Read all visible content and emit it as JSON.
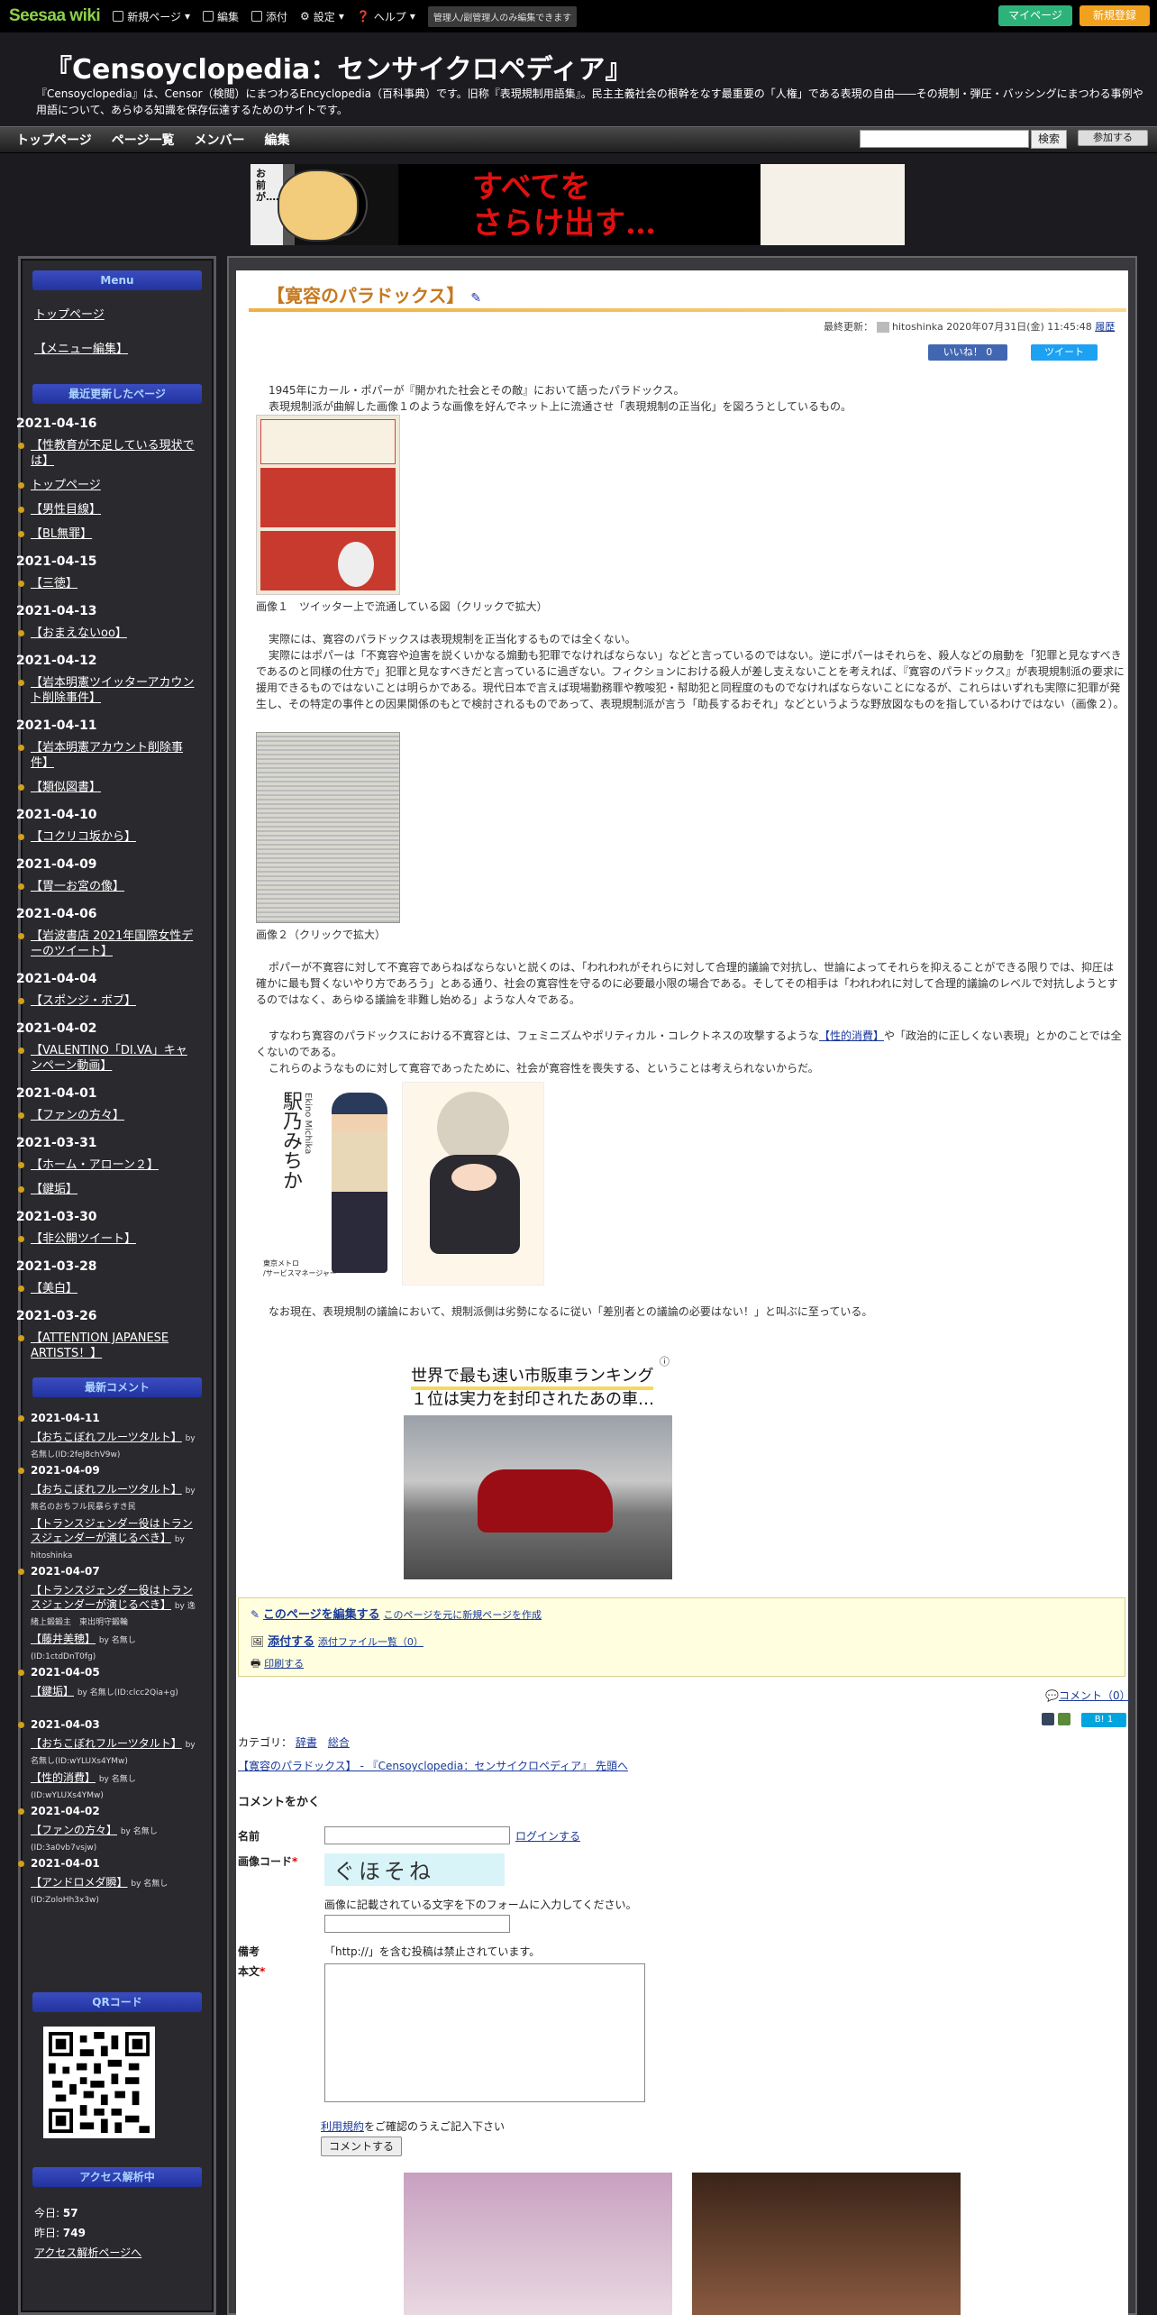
{
  "topbar": {
    "logo": "Seesaa",
    "logo_wiki": "wiki",
    "menu": [
      "新規ページ",
      "編集",
      "添付",
      "設定",
      "ヘルプ"
    ],
    "note": "管理人/副管理人のみ編集できます",
    "mypage": "マイページ",
    "new_register": "新規登録"
  },
  "header": {
    "title": "『Censoyclopedia：センサイクロペディア』",
    "description": "『Censoyclopedia』は、Censor（検閲）にまつわるEncyclopedia（百科事典）です。旧称『表現規制用語集』。民主主義社会の根幹をなす最重要の「人権」である表現の自由――その規制・弾圧・バッシングにまつわる事例や用語について、あらゆる知識を保存伝達するためのサイトです。"
  },
  "nav": {
    "items": [
      "トップページ",
      "ページ一覧",
      "メンバー",
      "編集"
    ],
    "search_button": "検索",
    "join_button": "参加する"
  },
  "banner": {
    "left_text": "お前が……",
    "main_line1": "すべてを",
    "main_line2": "さらけ出す…"
  },
  "sidebar": {
    "menu_title": "Menu",
    "menu_links": [
      "トップページ",
      "【メニュー編集】"
    ],
    "recent_title": "最近更新したページ",
    "recent": [
      {
        "date": "2021-04-16",
        "items": [
          "【性教育が不足している現状では】",
          "トップページ",
          "【男性目線】",
          "【BL無罪】"
        ]
      },
      {
        "date": "2021-04-15",
        "items": [
          "【三徳】"
        ]
      },
      {
        "date": "2021-04-13",
        "items": [
          "【おまえないoo】"
        ]
      },
      {
        "date": "2021-04-12",
        "items": [
          "【岩本明憲ツイッターアカウント削除事件】"
        ]
      },
      {
        "date": "2021-04-11",
        "items": [
          "【岩本明憲アカウント削除事件】",
          "【類似図書】"
        ]
      },
      {
        "date": "2021-04-10",
        "items": [
          "【コクリコ坂から】"
        ]
      },
      {
        "date": "2021-04-09",
        "items": [
          "【胃一お宮の像】"
        ]
      },
      {
        "date": "2021-04-06",
        "items": [
          "【岩波書店 2021年国際女性デーのツイート】"
        ]
      },
      {
        "date": "2021-04-04",
        "items": [
          "【スポンジ・ボブ】"
        ]
      },
      {
        "date": "2021-04-02",
        "items": [
          "【VALENTINO「DI.VA」キャンペーン動画】"
        ]
      },
      {
        "date": "2021-04-01",
        "items": [
          "【ファンの方々】"
        ]
      },
      {
        "date": "2021-03-31",
        "items": [
          "【ホーム・アローン２】",
          "【鍵垢】"
        ]
      },
      {
        "date": "2021-03-30",
        "items": [
          "【非公開ツイート】"
        ]
      },
      {
        "date": "2021-03-28",
        "items": [
          "【美白】"
        ]
      },
      {
        "date": "2021-03-26",
        "items": [
          "【ATTENTION JAPANESE ARTISTS！】"
        ]
      }
    ],
    "comments_title": "最新コメント",
    "comments": [
      {
        "date": "2021-04-11",
        "entries": [
          {
            "title": "【おちこぼれフルーツタルト】",
            "by": "by 名無し(ID:2feJ8chV9w)"
          }
        ]
      },
      {
        "date": "2021-04-09",
        "entries": [
          {
            "title": "【おちこぼれフルーツタルト】",
            "by": "by 無名のおちフル民暴らすき民"
          },
          {
            "title": "【トランスジェンダー役はトランスジェンダーが演じるべき】",
            "by": "by hitoshinka"
          }
        ]
      },
      {
        "date": "2021-04-07",
        "entries": [
          {
            "title": "【トランスジェンダー役はトランスジェンダーが演じるべき】",
            "by": "by 逸緒上鍛鍛主　東出明守鍛輪"
          },
          {
            "title": "【藤井美穂】",
            "by": "by 名無し(ID:1ctdDnT0fg)"
          }
        ]
      },
      {
        "date": "2021-04-05",
        "entries": [
          {
            "title": "【鍵垢】",
            "by": "by 名無し(ID:clcc2Qia+g)"
          }
        ]
      },
      {
        "date": "2021-04-03",
        "entries": [
          {
            "title": "【おちこぼれフルーツタルト】",
            "by": "by 名無し(ID:wYLUXs4YMw)"
          },
          {
            "title": "【性的消費】",
            "by": "by 名無し(ID:wYLUXs4YMw)"
          }
        ]
      },
      {
        "date": "2021-04-02",
        "entries": [
          {
            "title": "【ファンの方々】",
            "by": "by 名無し(ID:3a0vb7vsjw)"
          }
        ]
      },
      {
        "date": "2021-04-01",
        "entries": [
          {
            "title": "【アンドロメダ瞬】",
            "by": "by 名無し(ID:ZoloHh3x3w)"
          }
        ]
      }
    ],
    "qr_title": "QRコード",
    "access_title": "アクセス解析中",
    "today_label": "今日:",
    "today_value": "57",
    "yesterday_label": "昨日:",
    "yesterday_value": "749",
    "access_link": "アクセス解析ページへ"
  },
  "page": {
    "title": "【寛容のパラドックス】",
    "updated_label": "最終更新：",
    "updated_user": "hitoshinka",
    "updated_date": "2020年07月31日(金) 11:45:48",
    "history": "履歴",
    "like": "いいね！ 0",
    "tweet": "ツイート",
    "p1a": "1945年にカール・ポパーが『開かれた社会とその敵』において語ったパラドックス。",
    "p1b": "表現規制派が曲解した画像１のような画像を好んでネット上に流通させ「表現規制の正当化」を図ろうとしているもの。",
    "cap1": "画像１　ツイッター上で流通している図（クリックで拡大）",
    "p2a": "実際には、寛容のパラドックスは表現規制を正当化するものでは全くない。",
    "p2b": "実際にはポパーは「不寛容や迫害を説くいかなる煽動も犯罪でなければならない」などと言っているのではない。逆にポパーはそれらを、殺人などの扇動を「犯罪と見なすべきであるのと同様の仕方で」犯罪と見なすべきだと言っているに過ぎない。フィクションにおける殺人が差し支えないことを考えれば、『寛容のパラドックス』が表現規制派の要求に援用できるものではないことは明らかである。現代日本で言えば現場勤務罪や教唆犯・幇助犯と同程度のものでなければならないことになるが、これらはいずれも実際に犯罪が発生し、その特定の事件との因果関係のもとで検討されるものであって、表現規制派が言う「助長するおそれ」などというような野放図なものを指しているわけではない（画像２）。",
    "cap2": "画像２（クリックで拡大）",
    "p3": "ポパーが不寛容に対して不寛容であらねばならないと説くのは、「われわれがそれらに対して合理的議論で対抗し、世論によってそれらを抑えることができる限りでは、抑圧は確かに最も賢くないやり方であろう」とある通り、社会の寛容性を守るのに必要最小限の場合である。そしてその相手は「われわれに対して合理的議論のレベルで対抗しようとするのではなく、あらゆる議論を非難し始める」ような人々である。",
    "p4a": "すなわち寛容のパラドックスにおける不寛容とは、フェミニズムやポリティカル・コレクトネスの攻撃するような",
    "p4link": "【性的消費】",
    "p4b": "や「政治的に正しくない表現」とかのことでは全くないのである。",
    "p4c": "これらのようなものに対して寛容であったために、社会が寛容性を喪失する、ということは考えられないからだ。",
    "img3_name": "駅乃みちか",
    "img3_romaji": "Ekino Michika",
    "img3_caption": "東京メトロ\n/サービスマネージャー",
    "p5": "なお現在、表現規制の議論において、規制派側は劣勢になるに従い「差別者との議論の必要はない！」と叫ぶに至っている。",
    "ad_title": "世界で最も速い市販車ランキング",
    "ad_sub": "１位は実力を封印されたあの車…",
    "edit_link": "このページを編集する",
    "edit_new": "このページを元に新規ページを作成",
    "attach_link": "添付する",
    "attach_list": "添付ファイル一覧（0）",
    "print_link": "印刷する",
    "comment_count": "コメント（0）",
    "hatena": "B! 1",
    "category_label": "カテゴリ：",
    "categories": [
      "辞書",
      "総合"
    ],
    "crumb": "【寛容のパラドックス】 - 『Censoyclopedia：センサイクロペディア』 先頭へ",
    "comment_heading": "コメントをかく",
    "name_label": "名前",
    "login_link": "ログインする",
    "code_label": "画像コード",
    "captcha_text": "ぐほそね",
    "code_note": "画像に記載されている文字を下のフォームに入力してください。",
    "note_label": "備考",
    "note_text": "「http://」を含む投稿は禁止されています。",
    "body_label": "本文",
    "terms_link": "利用規約",
    "terms_text": "をご確認のうえご記入下さい",
    "submit": "コメントする"
  },
  "colors": {
    "accent": "#c6781e",
    "sidebar_head": "#2233a0",
    "mypage": "#2db37a",
    "new_register": "#f0a21e"
  }
}
